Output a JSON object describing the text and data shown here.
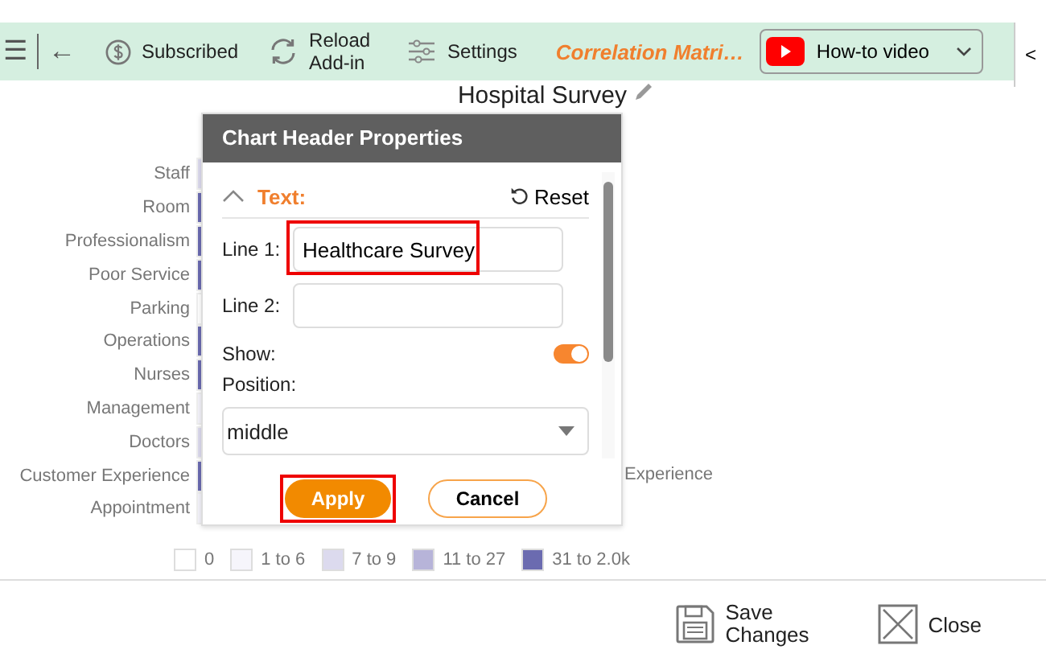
{
  "toolbar": {
    "items": [
      {
        "kind": "menu",
        "label": "☰"
      },
      {
        "kind": "back",
        "label": "←"
      },
      {
        "kind": "subscribed",
        "label": "Subscribed"
      },
      {
        "kind": "reload",
        "label": "Reload Add-in"
      },
      {
        "kind": "settings",
        "label": "Settings"
      }
    ],
    "app_title": "Correlation Matri…",
    "video_button": "How-to video",
    "side_toggle": "<"
  },
  "chart": {
    "title": "Hospital Survey",
    "rows": [
      {
        "label": "Staff",
        "color": "#dcdaee"
      },
      {
        "label": "Room",
        "color": "#6b6bb0"
      },
      {
        "label": "Professionalism",
        "color": "#6b6bb0"
      },
      {
        "label": "Poor Service",
        "color": "#6b6bb0"
      },
      {
        "label": "Parking",
        "color": "#ffffff"
      },
      {
        "label": "Operations",
        "color": "#6b6bb0"
      },
      {
        "label": "Nurses",
        "color": "#6b6bb0"
      },
      {
        "label": "Management",
        "color": "#f4f3fa"
      },
      {
        "label": "Doctors",
        "color": "#dcdaee"
      },
      {
        "label": "Customer Experience",
        "color": "#6b6bb0"
      },
      {
        "label": "Appointment",
        "color": "#f4f3fa"
      }
    ],
    "column_label": "Experience",
    "legend": [
      {
        "label": "0",
        "color": "#ffffff"
      },
      {
        "label": "1 to 6",
        "color": "#f6f5fb"
      },
      {
        "label": "7 to 9",
        "color": "#dcdaee"
      },
      {
        "label": "11 to 27",
        "color": "#b7b4d9"
      },
      {
        "label": "31 to 2.0k",
        "color": "#6b6bb0"
      }
    ]
  },
  "dialog": {
    "title": "Chart Header Properties",
    "section": "Text:",
    "expanded": true,
    "reset": "Reset",
    "line1_label": "Line 1:",
    "line1_value": "Healthcare Survey",
    "line2_label": "Line 2:",
    "show_label": "Show:",
    "show_on": true,
    "position_label": "Position:",
    "position_value": "middle",
    "apply": "Apply",
    "cancel": "Cancel"
  },
  "footer": {
    "save": "Save Changes",
    "close": "Close"
  }
}
